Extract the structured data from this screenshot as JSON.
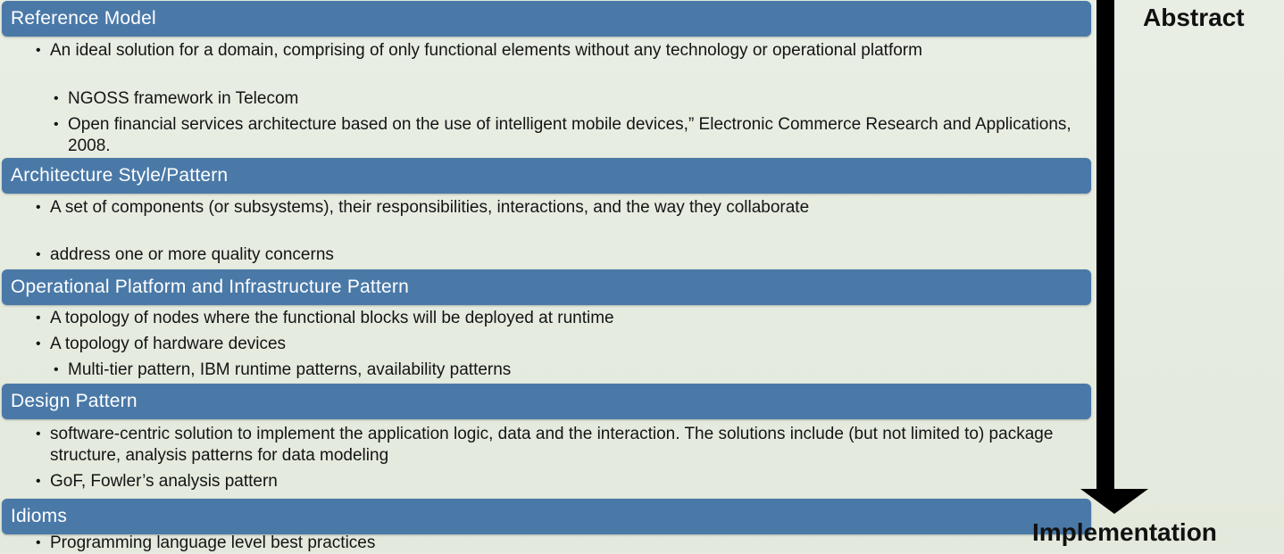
{
  "sections": [
    {
      "header": "Reference Model",
      "items": [
        {
          "text": "An ideal solution for a domain, comprising of only functional elements without any technology or operational platform"
        },
        {
          "text": "NGOSS framework in Telecom"
        },
        {
          "text": "Open financial services architecture based on the use of intelligent mobile devices,” Electronic Commerce Research and Applications, 2008."
        }
      ]
    },
    {
      "header": "Architecture Style/Pattern",
      "items": [
        {
          "text": "A set of components (or subsystems), their responsibilities, interactions, and the way they collaborate"
        },
        {
          "text": "address one or more quality concerns"
        }
      ]
    },
    {
      "header": "Operational Platform and Infrastructure Pattern",
      "items": [
        {
          "text": "A topology of nodes where the functional blocks will be deployed at runtime"
        },
        {
          "text": "A topology of hardware devices"
        },
        {
          "text": "Multi-tier pattern, IBM runtime patterns, availability patterns"
        }
      ]
    },
    {
      "header": "Design Pattern",
      "items": [
        {
          "text": "software-centric solution to implement the application logic, data and the interaction. The solutions include (but not limited to) package structure, analysis patterns for data modeling"
        },
        {
          "text": "GoF, Fowler’s analysis pattern"
        }
      ]
    },
    {
      "header": "Idioms",
      "items": [
        {
          "text": "Programming language level best practices"
        }
      ]
    }
  ],
  "arrow": {
    "top_label": "Abstract",
    "bottom_label": "Implementation"
  },
  "bullet": "•",
  "colors": {
    "header_bar": "#4a79a8",
    "background": "#e6ebdf",
    "arrow": "#000000"
  }
}
